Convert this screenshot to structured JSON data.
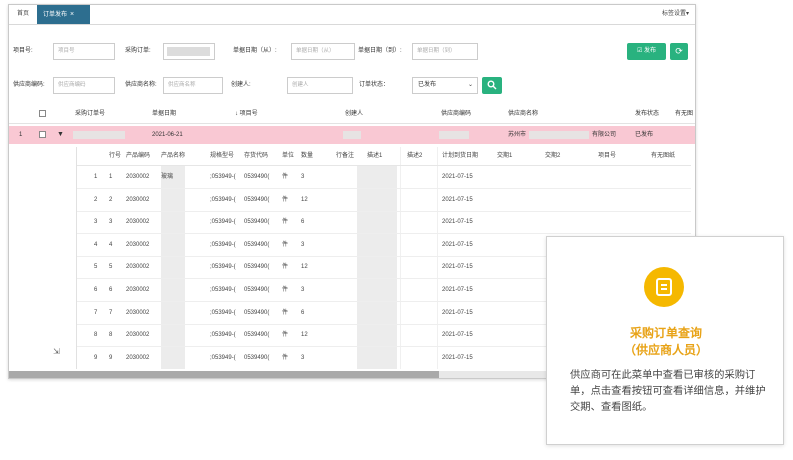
{
  "tabs": {
    "home": "首页",
    "active": "订单发布",
    "close": "×",
    "settings": "标签设置▾"
  },
  "filters": {
    "order_no_label": "项目号:",
    "order_no_placeholder": "项目号",
    "po_label": "采购订单:",
    "date_from_label": "单据日期（从）:",
    "date_from_placeholder": "单据日期（从）",
    "date_to_label": "单据日期（到）:",
    "date_to_placeholder": "单据日期（到）",
    "publish_button": "☑ 发布",
    "refresh_button": "⟳",
    "supplier_code_label": "供应商编码:",
    "supplier_code_placeholder": "供应商编码",
    "supplier_name_label": "供应商名称:",
    "supplier_name_placeholder": "供应商名称",
    "creator_label": "创建人:",
    "creator_placeholder": "创建人",
    "status_label": "订单状态：",
    "status_value": "已发布",
    "search_button": "🔍"
  },
  "main_table": {
    "headers": [
      "采购订单号",
      "单据日期",
      "↓ 项目号",
      "创建人",
      "供应商编码",
      "供应商名称",
      "发布状态",
      "有无图"
    ],
    "row": {
      "index": "1",
      "date": "2021-06-21",
      "supplier_prefix": "苏州市",
      "supplier_suffix": "有限公司",
      "status": "已发布"
    }
  },
  "sub_table": {
    "headers": [
      "行号",
      "产品编码",
      "产品名称",
      "规格型号",
      "存货代码",
      "单位",
      "数量",
      "行备注",
      "描述1",
      "描述2",
      "计划到货日期",
      "交期1",
      "交期2",
      "项目号",
      "有无图纸"
    ],
    "rows": [
      {
        "a": "1",
        "b": "1",
        "code": "2030002",
        "name": "玻璃",
        "spec": ";053949-(",
        "inv": "0539490(",
        "unit": "件",
        "qty": "3",
        "date": "2021-07-15"
      },
      {
        "a": "2",
        "b": "2",
        "code": "2030002",
        "name": "",
        "spec": ";053949-(",
        "inv": "0539490(",
        "unit": "件",
        "qty": "12",
        "date": "2021-07-15"
      },
      {
        "a": "3",
        "b": "3",
        "code": "2030002",
        "name": "",
        "spec": ";053949-(",
        "inv": "0539490(",
        "unit": "件",
        "qty": "6",
        "date": "2021-07-15"
      },
      {
        "a": "4",
        "b": "4",
        "code": "2030002",
        "name": "",
        "spec": ";053949-(",
        "inv": "0539490(",
        "unit": "件",
        "qty": "3",
        "date": "2021-07-15"
      },
      {
        "a": "5",
        "b": "5",
        "code": "2030002",
        "name": "",
        "spec": ";053949-(",
        "inv": "0539490(",
        "unit": "件",
        "qty": "12",
        "date": "2021-07-15"
      },
      {
        "a": "6",
        "b": "6",
        "code": "2030002",
        "name": "",
        "spec": ";053949-(",
        "inv": "0539490(",
        "unit": "件",
        "qty": "3",
        "date": "2021-07-15"
      },
      {
        "a": "7",
        "b": "7",
        "code": "2030002",
        "name": "",
        "spec": ";053949-(",
        "inv": "0539490(",
        "unit": "件",
        "qty": "6",
        "date": "2021-07-15"
      },
      {
        "a": "8",
        "b": "8",
        "code": "2030002",
        "name": "",
        "spec": ";053949-(",
        "inv": "0539490(",
        "unit": "件",
        "qty": "12",
        "date": "2021-07-15"
      },
      {
        "a": "9",
        "b": "9",
        "code": "2030002",
        "name": "",
        "spec": ";053949-(",
        "inv": "0539490(",
        "unit": "件",
        "qty": "3",
        "date": "2021-07-15"
      }
    ]
  },
  "callout": {
    "title_line1": "采购订单查询",
    "title_line2": "（供应商人员）",
    "description": "供应商可在此菜单中查看已审核的采购订单，点击查看按钮可查看详细信息，并维护交期、查看图纸。",
    "accent_color": "#f5b800"
  }
}
